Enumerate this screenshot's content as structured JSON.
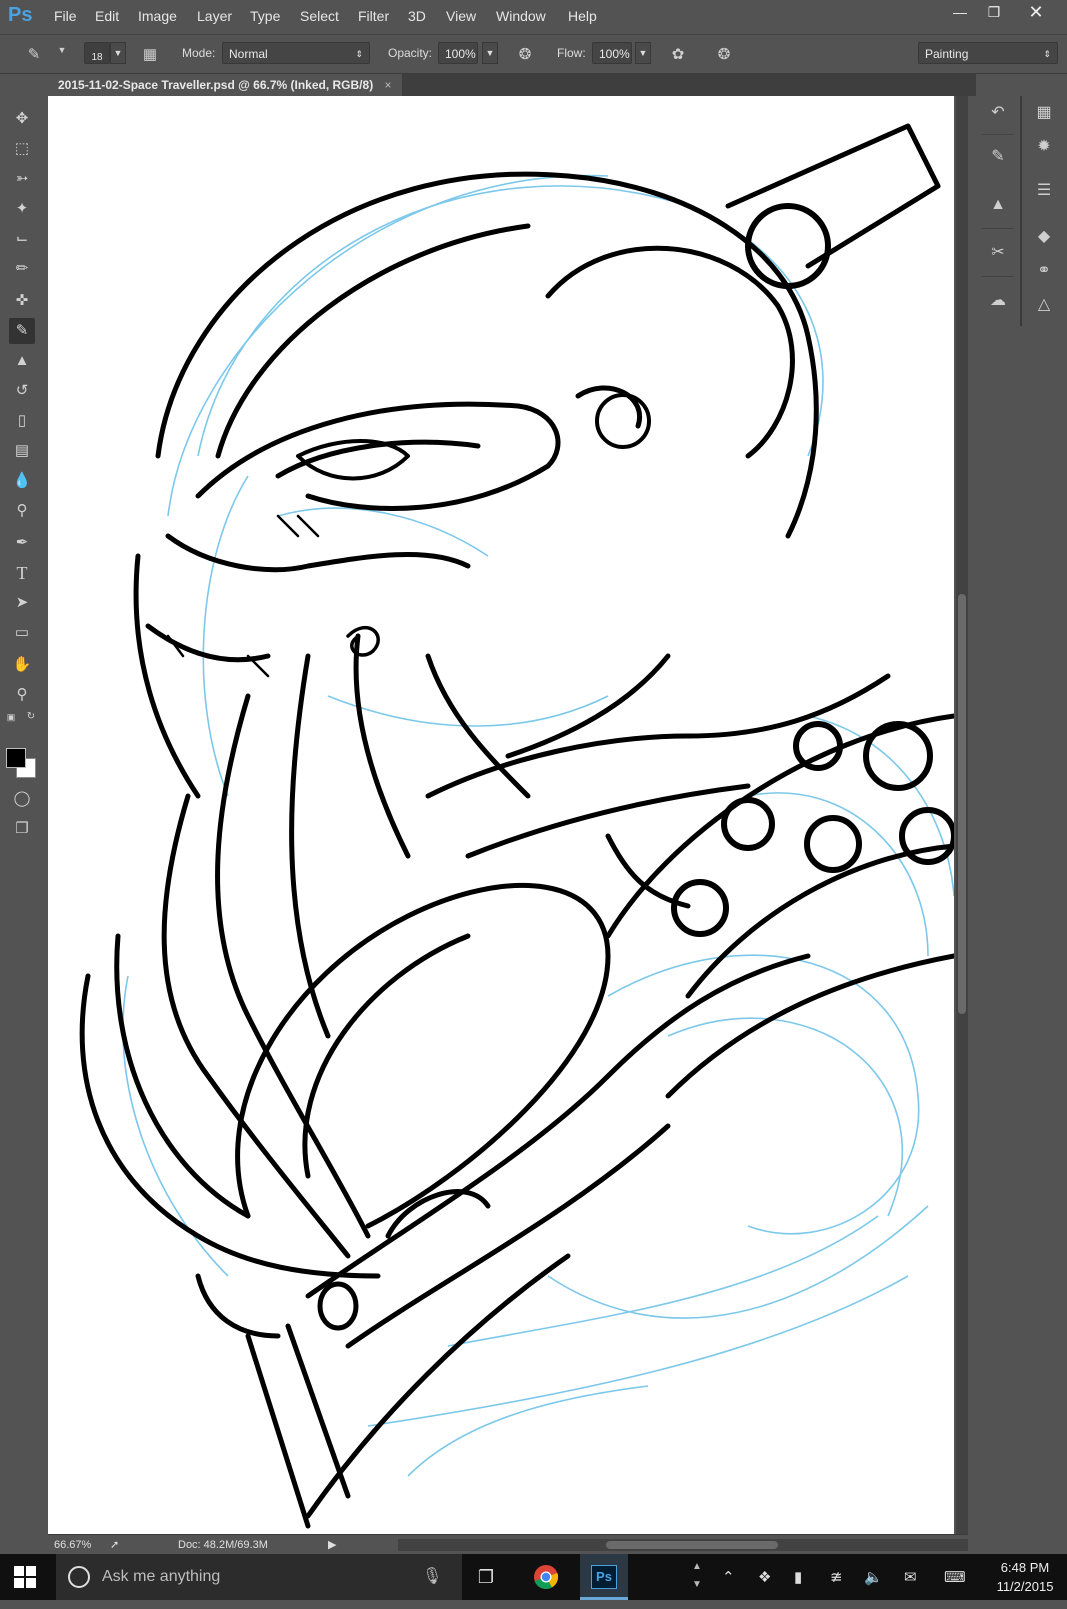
{
  "app": {
    "logo": "Ps",
    "menu": [
      "File",
      "Edit",
      "Image",
      "Layer",
      "Type",
      "Select",
      "Filter",
      "3D",
      "View",
      "Window",
      "Help"
    ],
    "window_controls": [
      "minimize",
      "restore",
      "close"
    ]
  },
  "options_bar": {
    "brush_size": "18",
    "mode_label": "Mode:",
    "mode_value": "Normal",
    "opacity_label": "Opacity:",
    "opacity_value": "100%",
    "flow_label": "Flow:",
    "flow_value": "100%",
    "workspace": "Painting"
  },
  "document": {
    "tab_title": "2015-11-02-Space Traveller.psd @ 66.7% (Inked, RGB/8)",
    "close_symbol": "×"
  },
  "toolbar": {
    "tools": [
      {
        "name": "move-tool",
        "icon": "move-icon"
      },
      {
        "name": "marquee-tool",
        "icon": "rect-marquee-icon"
      },
      {
        "name": "lasso-tool",
        "icon": "lasso-icon"
      },
      {
        "name": "quick-select-tool",
        "icon": "quick-select-icon"
      },
      {
        "name": "crop-tool",
        "icon": "crop-icon"
      },
      {
        "name": "eyedropper-tool",
        "icon": "eyedropper-icon"
      },
      {
        "name": "healing-tool",
        "icon": "bandage-icon"
      },
      {
        "name": "brush-tool",
        "icon": "brush-icon",
        "active": true
      },
      {
        "name": "stamp-tool",
        "icon": "stamp-icon"
      },
      {
        "name": "history-brush-tool",
        "icon": "history-brush-icon"
      },
      {
        "name": "eraser-tool",
        "icon": "eraser-icon"
      },
      {
        "name": "gradient-tool",
        "icon": "gradient-icon"
      },
      {
        "name": "blur-tool",
        "icon": "blur-icon"
      },
      {
        "name": "dodge-tool",
        "icon": "dodge-icon"
      },
      {
        "name": "pen-tool",
        "icon": "pen-icon"
      },
      {
        "name": "type-tool",
        "icon": "type-icon"
      },
      {
        "name": "path-select-tool",
        "icon": "arrow-icon"
      },
      {
        "name": "shape-tool",
        "icon": "rectangle-icon"
      },
      {
        "name": "hand-tool",
        "icon": "hand-icon"
      },
      {
        "name": "zoom-tool",
        "icon": "zoom-icon"
      }
    ],
    "foreground_color": "#000000",
    "background_color": "#ffffff"
  },
  "right_dock": {
    "column1": [
      "history-icon",
      "brush-presets-icon",
      "clone-source-icon",
      "tool-presets-icon",
      "libraries-icon"
    ],
    "column2": [
      "swatches-icon",
      "color-wheel-icon",
      "adjustments-icon",
      "layers-icon",
      "channels-icon",
      "paths-icon"
    ]
  },
  "status_bar": {
    "zoom": "66.67%",
    "doc_size": "Doc: 48.2M/69.3M"
  },
  "taskbar": {
    "search_placeholder": "Ask me anything",
    "time": "6:48 PM",
    "date": "11/2/2015"
  },
  "colors": {
    "ui_gray": "#535353",
    "sketch_blue": "#7cc8ea",
    "ink": "#000000",
    "ps_blue": "#4aa3e0"
  }
}
